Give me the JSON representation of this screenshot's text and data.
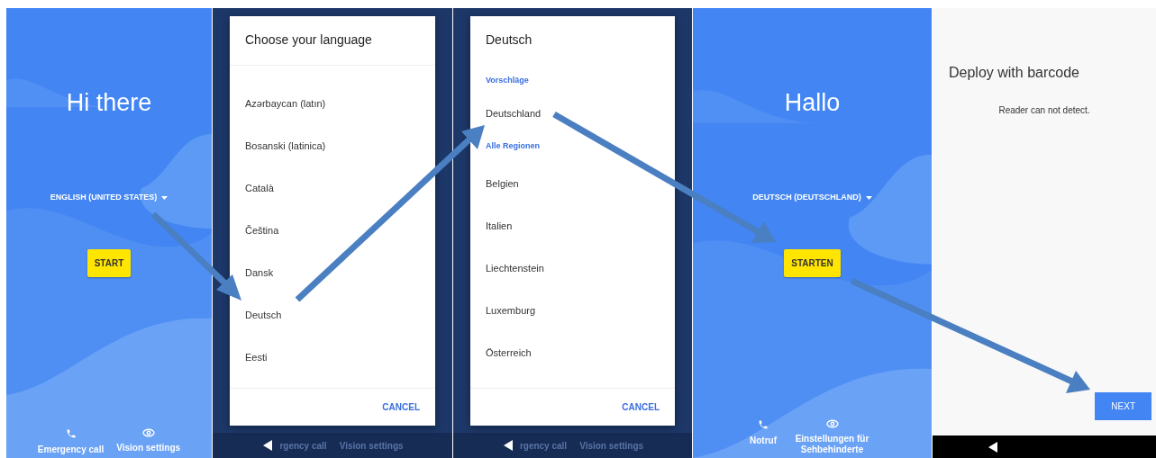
{
  "screens": [
    {
      "kind": "welcome",
      "title": "Hi there",
      "language": "ENGLISH (UNITED STATES)",
      "start_button": "START",
      "bottom_actions": [
        {
          "kind": "phone",
          "label": "Emergency call"
        },
        {
          "kind": "eye",
          "label": "Vision settings"
        }
      ]
    },
    {
      "kind": "dialog",
      "title": "Choose your language",
      "items": [
        {
          "kind": "item",
          "label": "Azərbaycan (latın)"
        },
        {
          "kind": "item",
          "label": "Bosanski (latinica)"
        },
        {
          "kind": "item",
          "label": "Català"
        },
        {
          "kind": "item",
          "label": "Čeština"
        },
        {
          "kind": "item",
          "label": "Dansk"
        },
        {
          "kind": "item",
          "label": "Deutsch"
        },
        {
          "kind": "item",
          "label": "Eesti"
        }
      ],
      "cancel": "CANCEL",
      "background_actions": [
        "rgency call",
        "Vision settings"
      ]
    },
    {
      "kind": "dialog",
      "title": "Deutsch",
      "items": [
        {
          "kind": "header",
          "label": "Vorschläge"
        },
        {
          "kind": "item",
          "label": "Deutschland"
        },
        {
          "kind": "header",
          "label": "Alle Regionen"
        },
        {
          "kind": "item",
          "label": "Belgien"
        },
        {
          "kind": "item",
          "label": "Italien"
        },
        {
          "kind": "item",
          "label": "Liechtenstein"
        },
        {
          "kind": "item",
          "label": "Luxemburg"
        },
        {
          "kind": "item",
          "label": "Österreich"
        }
      ],
      "cancel": "CANCEL",
      "background_actions": [
        "rgency call",
        "Vision settings"
      ]
    },
    {
      "kind": "welcome",
      "title": "Hallo",
      "language": "DEUTSCH (DEUTSCHLAND)",
      "start_button": "STARTEN",
      "bottom_actions": [
        {
          "kind": "phone",
          "label": "Notruf"
        },
        {
          "kind": "eye",
          "label": "Einstellungen für Sehbehinderte"
        }
      ]
    },
    {
      "kind": "barcode",
      "title": "Deploy with barcode",
      "message": "Reader can not detect.",
      "next_button": "NEXT"
    }
  ]
}
